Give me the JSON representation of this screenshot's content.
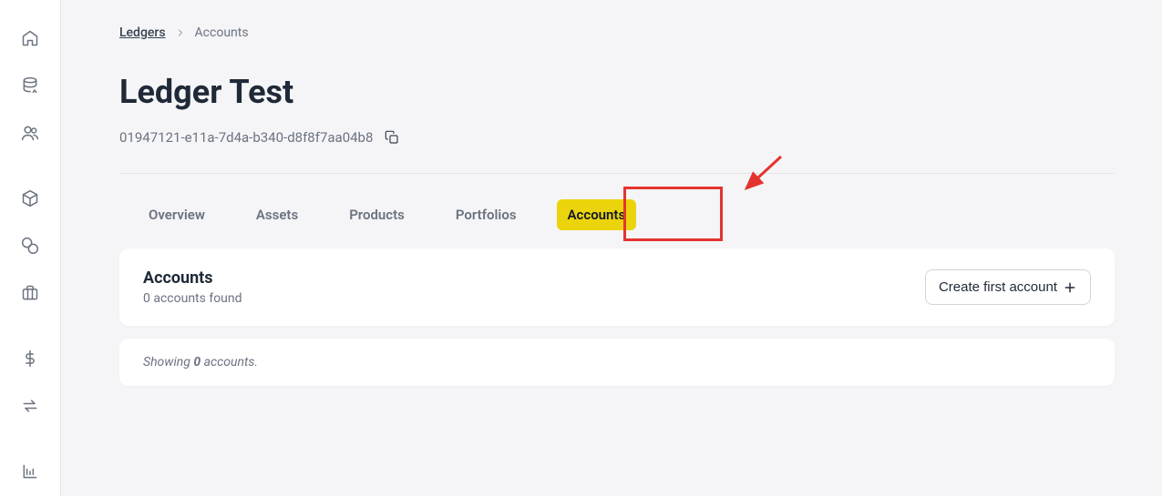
{
  "breadcrumb": {
    "parent": "Ledgers",
    "current": "Accounts"
  },
  "page": {
    "title": "Ledger Test",
    "ledger_id": "01947121-e11a-7d4a-b340-d8f8f7aa04b8"
  },
  "tabs": {
    "overview": "Overview",
    "assets": "Assets",
    "products": "Products",
    "portfolios": "Portfolios",
    "accounts": "Accounts"
  },
  "accounts_card": {
    "title": "Accounts",
    "subtitle": "0 accounts found",
    "create_label": "Create first account"
  },
  "summary": {
    "prefix": "Showing ",
    "count": "0",
    "suffix": " accounts."
  }
}
